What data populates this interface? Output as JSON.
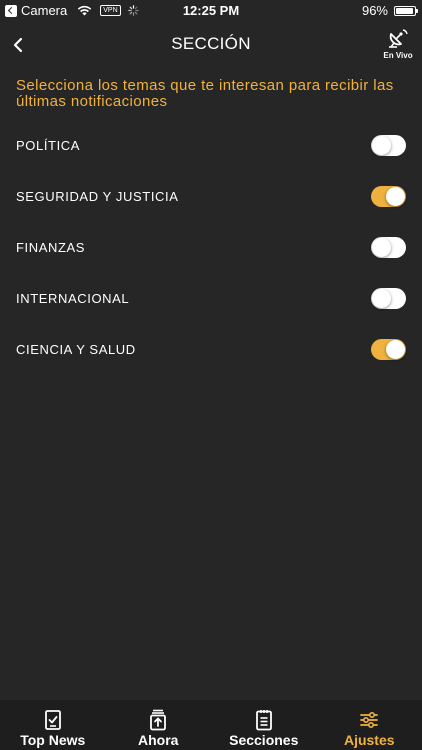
{
  "status_bar": {
    "carrier": "Camera",
    "vpn": "VPN",
    "time": "12:25 PM",
    "battery_percent": "96%",
    "battery_level": 0.96
  },
  "header": {
    "title": "SECCIÓN",
    "live_label": "En Vivo"
  },
  "intro_text": "Selecciona los temas que te interesan para recibir las últimas notificaciones",
  "topics": [
    {
      "label": "POLÍTICA",
      "enabled": false
    },
    {
      "label": "SEGURIDAD Y JUSTICIA",
      "enabled": true
    },
    {
      "label": "FINANZAS",
      "enabled": false
    },
    {
      "label": "INTERNACIONAL",
      "enabled": false
    },
    {
      "label": "CIENCIA Y SALUD",
      "enabled": true
    }
  ],
  "tabs": [
    {
      "label": "Top News",
      "icon": "checklist-icon",
      "active": false
    },
    {
      "label": "Ahora",
      "icon": "upload-tray-icon",
      "active": false
    },
    {
      "label": "Secciones",
      "icon": "document-list-icon",
      "active": false
    },
    {
      "label": "Ajustes",
      "icon": "sliders-icon",
      "active": true
    }
  ],
  "colors": {
    "background": "#262626",
    "accent": "#f0b23e",
    "tab_bar": "#1e1e1e"
  }
}
